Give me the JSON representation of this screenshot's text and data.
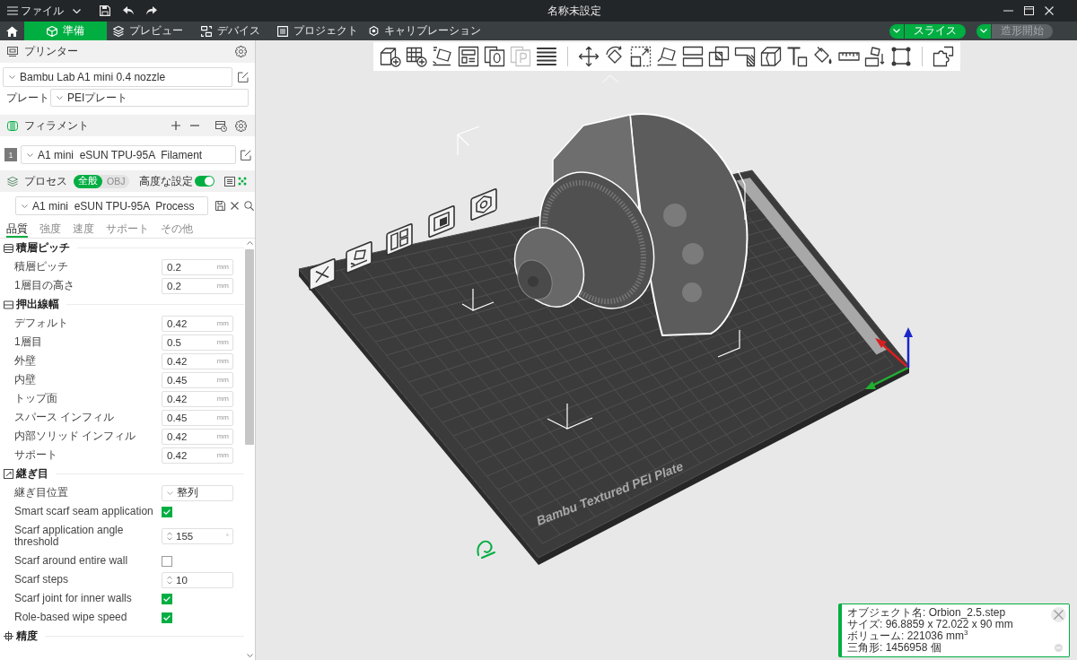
{
  "title_bar": {
    "menu": "ファイル",
    "title": "名称未設定"
  },
  "tabs": [
    {
      "kind": "prepare",
      "label": "準備",
      "selected": true
    },
    {
      "kind": "preview",
      "label": "プレビュー",
      "selected": false
    },
    {
      "kind": "device",
      "label": "デバイス",
      "selected": false
    },
    {
      "kind": "project",
      "label": "プロジェクト",
      "selected": false
    },
    {
      "kind": "calibration",
      "label": "キャリブレーション",
      "selected": false
    }
  ],
  "actions": [
    {
      "label": "スライス",
      "disabled": false
    },
    {
      "label": "造形開始",
      "disabled": true
    }
  ],
  "printer": {
    "title": "プリンター",
    "preset": "Bambu Lab A1 mini 0.4 nozzle",
    "plate_label": "プレート",
    "plate": "PEIプレート"
  },
  "filament": {
    "title": "フィラメント",
    "items": [
      {
        "number": "1",
        "color": "#7a7a7a",
        "preset": "A1 mini  eSUN TPU-95A  Filament"
      }
    ]
  },
  "process": {
    "title": "プロセス",
    "scope": [
      {
        "label": "全般",
        "selected": true
      },
      {
        "label": "OBJ",
        "selected": false
      }
    ],
    "advanced": {
      "label": "高度な設定",
      "on": true
    },
    "preset": "A1 mini  eSUN TPU-95A  Process",
    "tabs": [
      {
        "label": "品質",
        "selected": true
      },
      {
        "label": "強度",
        "selected": false
      },
      {
        "label": "速度",
        "selected": false
      },
      {
        "label": "サポート",
        "selected": false
      },
      {
        "label": "その他",
        "selected": false
      }
    ]
  },
  "settings": [
    {
      "kind": "layers",
      "title": "積層ピッチ",
      "rows": [
        {
          "kind": "number",
          "label": "積層ピッチ",
          "value": "0.2",
          "unit": "mm"
        },
        {
          "kind": "number",
          "label": "1層目の高さ",
          "value": "0.2",
          "unit": "mm"
        }
      ]
    },
    {
      "kind": "lines",
      "title": "押出線幅",
      "rows": [
        {
          "kind": "number",
          "label": "デフォルト",
          "value": "0.42",
          "unit": "mm"
        },
        {
          "kind": "number",
          "label": "1層目",
          "value": "0.5",
          "unit": "mm"
        },
        {
          "kind": "number",
          "label": "外壁",
          "value": "0.42",
          "unit": "mm"
        },
        {
          "kind": "number",
          "label": "内壁",
          "value": "0.45",
          "unit": "mm"
        },
        {
          "kind": "number",
          "label": "トップ面",
          "value": "0.42",
          "unit": "mm"
        },
        {
          "kind": "number",
          "label": "スパース インフィル",
          "value": "0.45",
          "unit": "mm"
        },
        {
          "kind": "number",
          "label": "内部ソリッド インフィル",
          "value": "0.42",
          "unit": "mm"
        },
        {
          "kind": "number",
          "label": "サポート",
          "value": "0.42",
          "unit": "mm"
        }
      ]
    },
    {
      "kind": "seam",
      "title": "継ぎ目",
      "rows": [
        {
          "kind": "select",
          "label": "継ぎ目位置",
          "value": "整列"
        },
        {
          "kind": "checkbox",
          "label": "Smart scarf seam application",
          "checked": true
        },
        {
          "kind": "spinner",
          "label": "Scarf application angle threshold",
          "value": "155",
          "unit": "°"
        },
        {
          "kind": "checkbox",
          "label": "Scarf around entire wall",
          "checked": false
        },
        {
          "kind": "spinner",
          "label": "Scarf steps",
          "value": "10"
        },
        {
          "kind": "checkbox",
          "label": "Scarf joint for inner walls",
          "checked": true
        },
        {
          "kind": "checkbox",
          "label": "Role-based wipe speed",
          "checked": true
        }
      ]
    },
    {
      "kind": "precision",
      "title": "精度"
    }
  ],
  "toolbar": [
    {
      "kind": "add",
      "disabled": false
    },
    {
      "kind": "plate",
      "disabled": false
    },
    {
      "kind": "orient",
      "disabled": false
    },
    {
      "kind": "arrange",
      "disabled": false
    },
    {
      "kind": "split",
      "disabled": false
    },
    {
      "kind": "parts",
      "disabled": true
    },
    {
      "kind": "layers",
      "disabled": false
    },
    {
      "kind": "separator"
    },
    {
      "kind": "move",
      "disabled": false
    },
    {
      "kind": "rotate",
      "disabled": false
    },
    {
      "kind": "scale",
      "disabled": false
    },
    {
      "kind": "face",
      "disabled": false
    },
    {
      "kind": "cut",
      "disabled": false
    },
    {
      "kind": "boolean",
      "disabled": false
    },
    {
      "kind": "support",
      "disabled": false
    },
    {
      "kind": "seam",
      "disabled": false
    },
    {
      "kind": "text",
      "disabled": false
    },
    {
      "kind": "paint",
      "disabled": false
    },
    {
      "kind": "measure",
      "disabled": false
    },
    {
      "kind": "assembly",
      "disabled": false
    },
    {
      "kind": "corners",
      "disabled": false
    },
    {
      "kind": "separator"
    },
    {
      "kind": "puzzle",
      "disabled": false
    }
  ],
  "viewport": {
    "plate_label": "Bambu Textured PEI Plate"
  },
  "object_info": {
    "lines": [
      "オブジェクト名: Orbion_2.5.step",
      "サイズ: 96.8859 x 72.022 x 90 mm",
      "ボリューム: 221036 mm$^{3}$",
      "三角形: 1456958 個"
    ]
  }
}
